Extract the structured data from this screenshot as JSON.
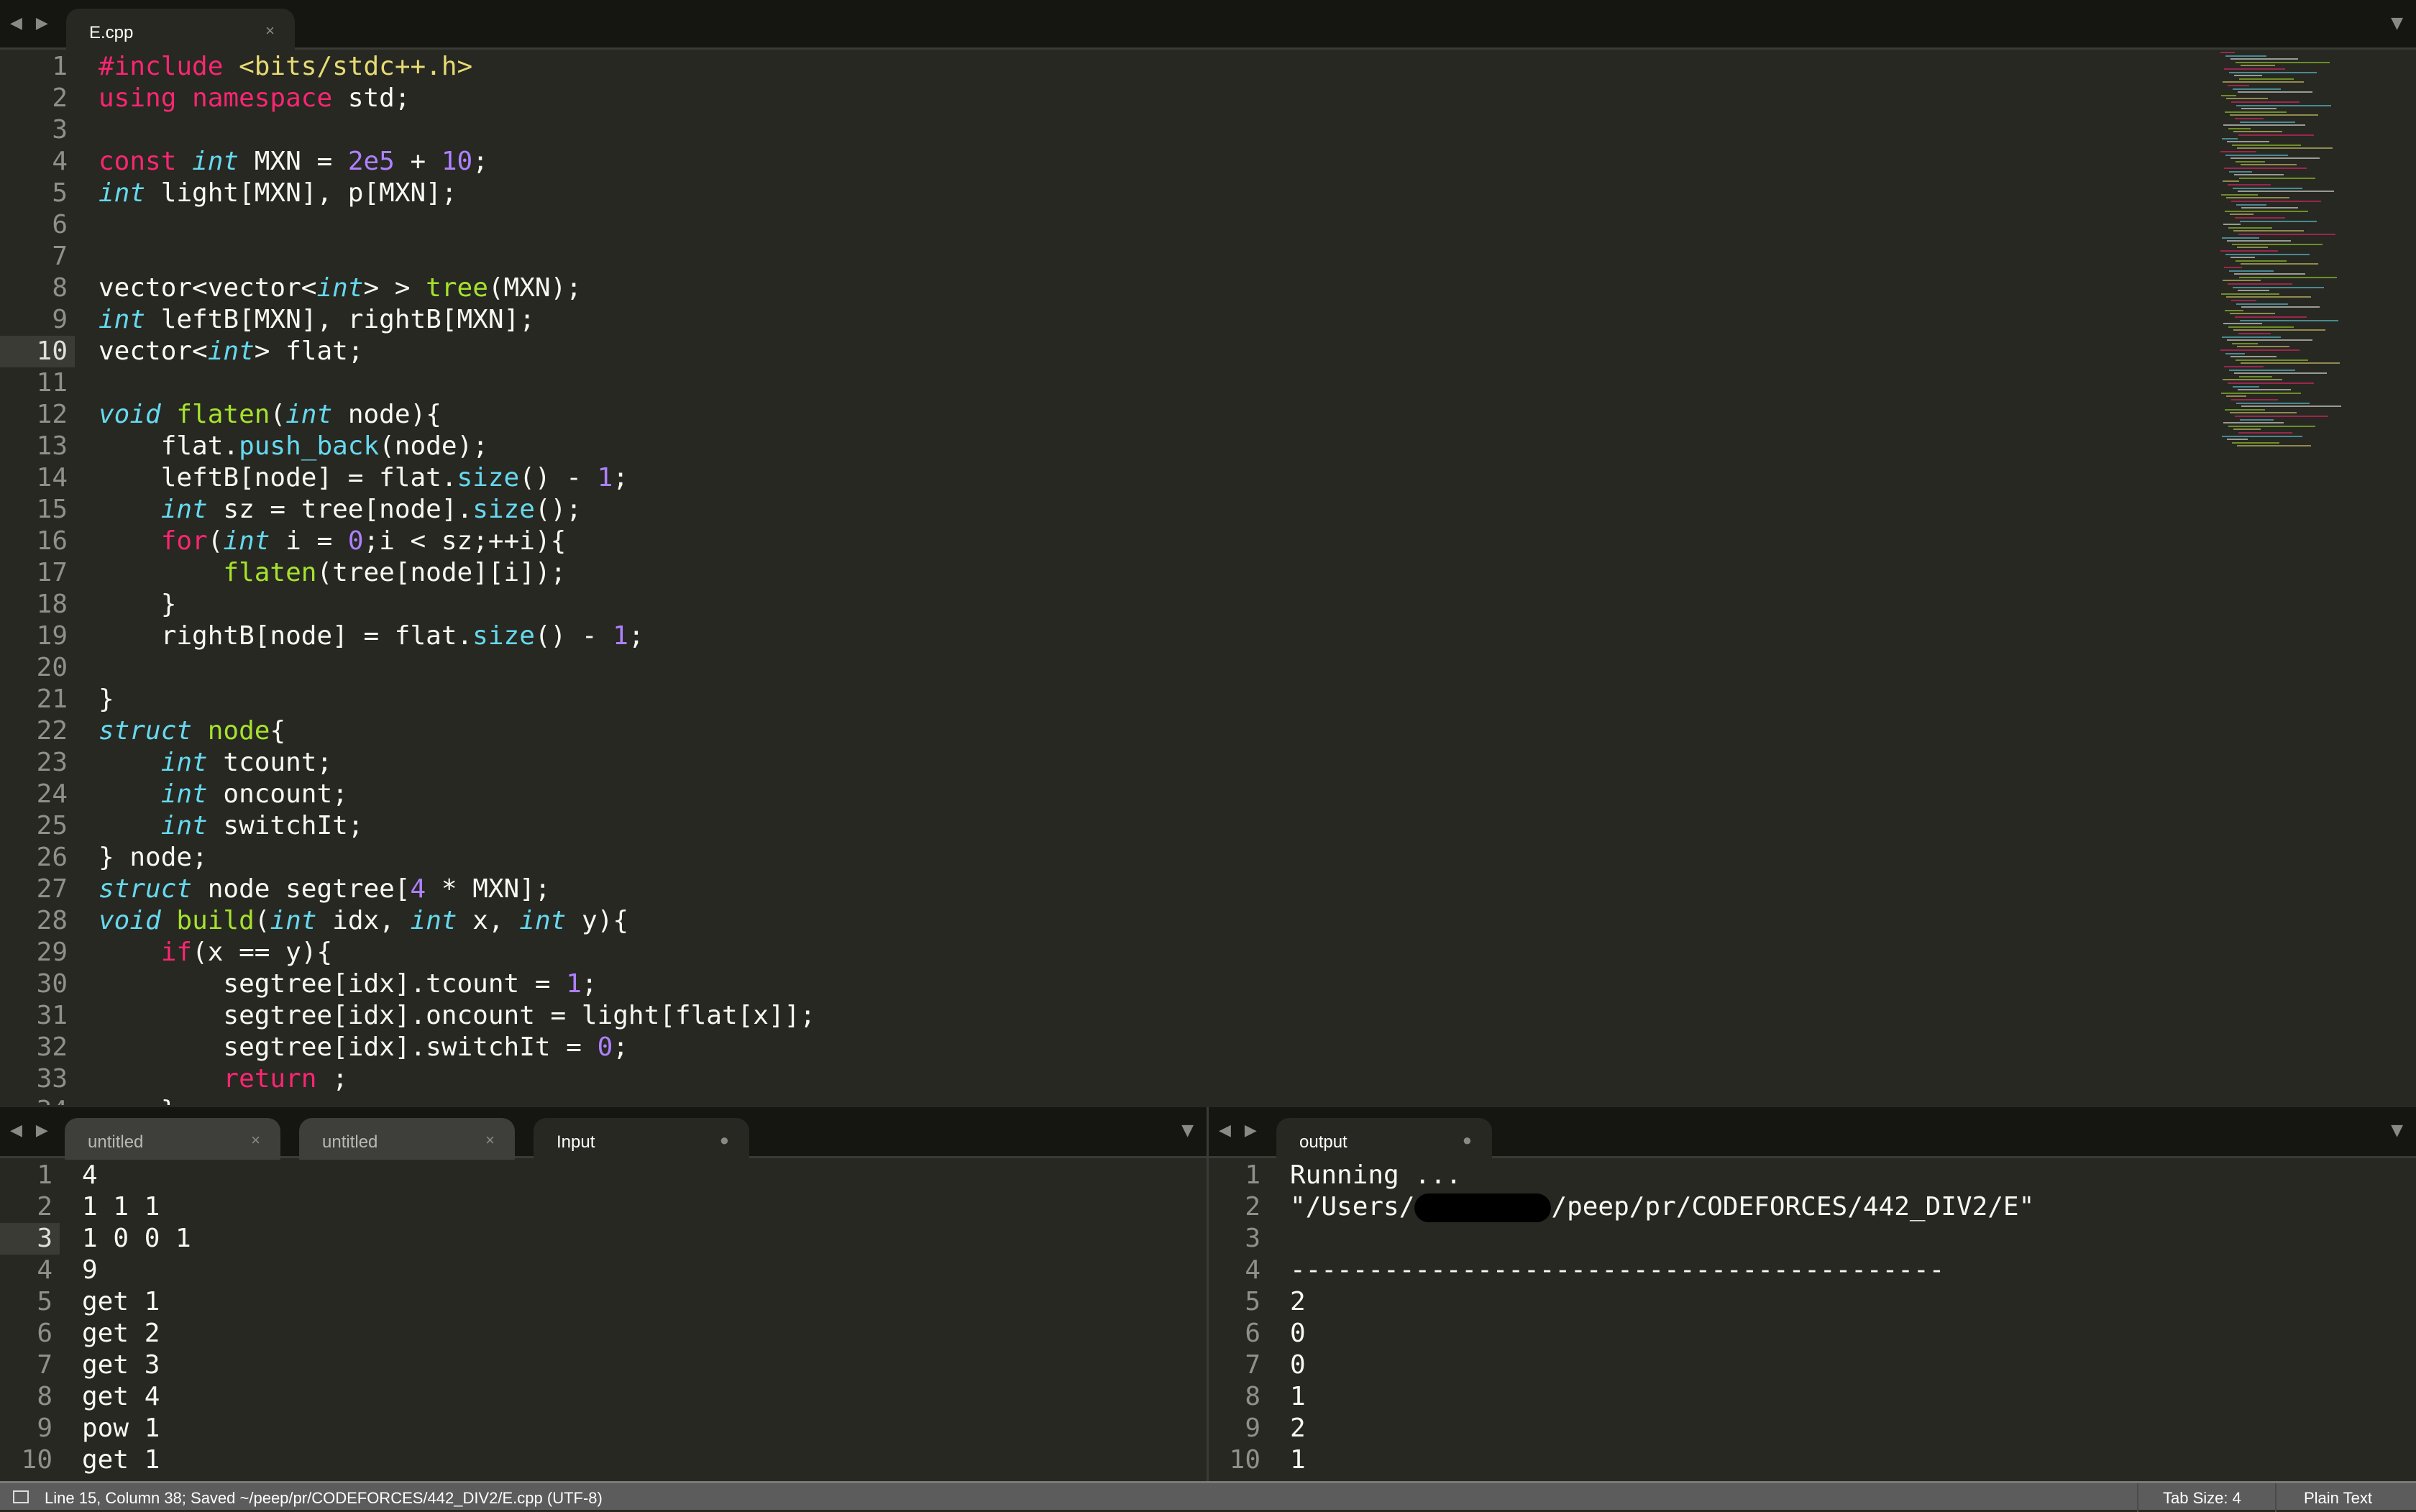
{
  "editor": {
    "tab": {
      "label": "E.cpp",
      "close": "×"
    },
    "current_line": 10,
    "code": [
      [
        [
          "k",
          "#include"
        ],
        [
          "p",
          " "
        ],
        [
          "s",
          "<bits/stdc++.h>"
        ]
      ],
      [
        [
          "k",
          "using"
        ],
        [
          "p",
          " "
        ],
        [
          "k",
          "namespace"
        ],
        [
          "p",
          " std;"
        ]
      ],
      [],
      [
        [
          "k",
          "const"
        ],
        [
          "p",
          " "
        ],
        [
          "t",
          "int"
        ],
        [
          "p",
          " MXN = "
        ],
        [
          "n",
          "2e5"
        ],
        [
          "p",
          " + "
        ],
        [
          "n",
          "10"
        ],
        [
          "p",
          ";"
        ]
      ],
      [
        [
          "t",
          "int"
        ],
        [
          "p",
          " light[MXN], p[MXN];"
        ]
      ],
      [],
      [],
      [
        [
          "p",
          "vector<vector<"
        ],
        [
          "t",
          "int"
        ],
        [
          "p",
          "> > "
        ],
        [
          "f",
          "tree"
        ],
        [
          "p",
          "(MXN);"
        ]
      ],
      [
        [
          "t",
          "int"
        ],
        [
          "p",
          " leftB[MXN], rightB[MXN];"
        ]
      ],
      [
        [
          "p",
          "vector<"
        ],
        [
          "t",
          "int"
        ],
        [
          "p",
          "> flat;"
        ]
      ],
      [],
      [
        [
          "t",
          "void"
        ],
        [
          "p",
          " "
        ],
        [
          "f",
          "flaten"
        ],
        [
          "p",
          "("
        ],
        [
          "t",
          "int"
        ],
        [
          "p",
          " node){"
        ]
      ],
      [
        [
          "p",
          "    flat."
        ],
        [
          "m",
          "push_back"
        ],
        [
          "p",
          "(node);"
        ]
      ],
      [
        [
          "p",
          "    leftB[node] = flat."
        ],
        [
          "m",
          "size"
        ],
        [
          "p",
          "() - "
        ],
        [
          "n",
          "1"
        ],
        [
          "p",
          ";"
        ]
      ],
      [
        [
          "p",
          "    "
        ],
        [
          "t",
          "int"
        ],
        [
          "p",
          " sz = tree[node]."
        ],
        [
          "m",
          "size"
        ],
        [
          "p",
          "();"
        ]
      ],
      [
        [
          "p",
          "    "
        ],
        [
          "k",
          "for"
        ],
        [
          "p",
          "("
        ],
        [
          "t",
          "int"
        ],
        [
          "p",
          " i = "
        ],
        [
          "n",
          "0"
        ],
        [
          "p",
          ";i < sz;++i){"
        ]
      ],
      [
        [
          "p",
          "        "
        ],
        [
          "f",
          "flaten"
        ],
        [
          "p",
          "(tree[node][i]);"
        ]
      ],
      [
        [
          "p",
          "    }"
        ]
      ],
      [
        [
          "p",
          "    rightB[node] = flat."
        ],
        [
          "m",
          "size"
        ],
        [
          "p",
          "() - "
        ],
        [
          "n",
          "1"
        ],
        [
          "p",
          ";"
        ]
      ],
      [],
      [
        [
          "p",
          "}"
        ]
      ],
      [
        [
          "t",
          "struct"
        ],
        [
          "p",
          " "
        ],
        [
          "f",
          "node"
        ],
        [
          "p",
          "{"
        ]
      ],
      [
        [
          "p",
          "    "
        ],
        [
          "t",
          "int"
        ],
        [
          "p",
          " tcount;"
        ]
      ],
      [
        [
          "p",
          "    "
        ],
        [
          "t",
          "int"
        ],
        [
          "p",
          " oncount;"
        ]
      ],
      [
        [
          "p",
          "    "
        ],
        [
          "t",
          "int"
        ],
        [
          "p",
          " switchIt;"
        ]
      ],
      [
        [
          "p",
          "} node;"
        ]
      ],
      [
        [
          "t",
          "struct"
        ],
        [
          "p",
          " node segtree["
        ],
        [
          "n",
          "4"
        ],
        [
          "p",
          " * MXN];"
        ]
      ],
      [
        [
          "t",
          "void"
        ],
        [
          "p",
          " "
        ],
        [
          "f",
          "build"
        ],
        [
          "p",
          "("
        ],
        [
          "t",
          "int"
        ],
        [
          "p",
          " idx, "
        ],
        [
          "t",
          "int"
        ],
        [
          "p",
          " x, "
        ],
        [
          "t",
          "int"
        ],
        [
          "p",
          " y){"
        ]
      ],
      [
        [
          "p",
          "    "
        ],
        [
          "k",
          "if"
        ],
        [
          "p",
          "(x == y){"
        ]
      ],
      [
        [
          "p",
          "        segtree[idx].tcount = "
        ],
        [
          "n",
          "1"
        ],
        [
          "p",
          ";"
        ]
      ],
      [
        [
          "p",
          "        segtree[idx].oncount = light[flat[x]];"
        ]
      ],
      [
        [
          "p",
          "        segtree[idx].switchIt = "
        ],
        [
          "n",
          "0"
        ],
        [
          "p",
          ";"
        ]
      ],
      [
        [
          "p",
          "        "
        ],
        [
          "k",
          "return"
        ],
        [
          "p",
          " ;"
        ]
      ],
      [
        [
          "p",
          "    }"
        ]
      ]
    ]
  },
  "input_group": {
    "tabs": [
      {
        "label": "untitled",
        "close": "×"
      },
      {
        "label": "untitled",
        "close": "×"
      },
      {
        "label": "Input",
        "close": "●"
      }
    ],
    "current_line": 3,
    "lines": [
      "4",
      "1 1 1",
      "1 0 0 1",
      "9",
      "get 1",
      "get 2",
      "get 3",
      "get 4",
      "pow 1",
      "get 1"
    ]
  },
  "output_group": {
    "tabs": [
      {
        "label": "output",
        "close": "●"
      }
    ],
    "lines": [
      "Running ...",
      "",
      "",
      "------------------------------------------",
      "2",
      "0",
      "0",
      "1",
      "2",
      "1"
    ],
    "path_prefix": "\"/Users/",
    "path_suffix": "/peep/pr/CODEFORCES/442_DIV2/E\""
  },
  "status": {
    "left": "Line 15, Column 38; Saved ~/peep/pr/CODEFORCES/442_DIV2/E.cpp (UTF-8)",
    "tab_size": "Tab Size: 4",
    "syntax": "Plain Text"
  },
  "icons": {
    "nav": "◀ ▶",
    "dropdown": "▼"
  }
}
